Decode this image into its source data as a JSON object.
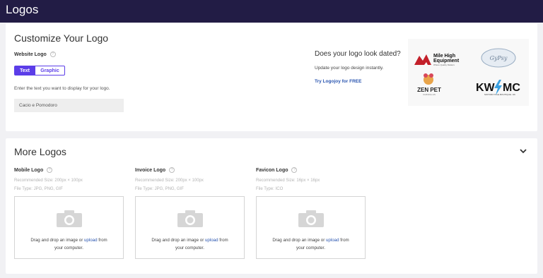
{
  "header": {
    "title": "Logos"
  },
  "customize": {
    "title": "Customize Your Logo",
    "website_logo_label": "Website Logo",
    "toggle": {
      "text": "Text",
      "graphic": "Graphic",
      "selected": "Text"
    },
    "instruction": "Enter the text you want to display for your logo.",
    "logo_text_value": "Cacio e Pomodoro"
  },
  "promo": {
    "title": "Does your logo look dated?",
    "subtitle": "Update your design instantly.",
    "subtitle_full": "Update your logo design instantly.",
    "link": "Try Logojoy for FREE",
    "samples": {
      "mile_high_1": "Mile High",
      "mile_high_2": "Equipment",
      "mile_high_3": "Where Quality Matters",
      "gypsy": "GyPsy",
      "zen_pet": "ZEN PET",
      "zen_pet_sub": "CHINCILLAS",
      "kwmc": "KW",
      "kwmc_2": "MC",
      "kwmc_sub": "MOTORCYCLE BOUTIQUE • 96"
    }
  },
  "more_logos": {
    "title": "More Logos",
    "items": [
      {
        "label": "Mobile Logo",
        "size": "Recommended Size: 200px × 100px",
        "type": "File Type: JPG, PNG, GIF"
      },
      {
        "label": "Invoice Logo",
        "size": "Recommended Size: 200px × 100px",
        "type": "File Type: JPG, PNG, GIF"
      },
      {
        "label": "Favicon Logo",
        "size": "Recommended Size: 16px × 16px",
        "type": "File Type: ICO"
      }
    ],
    "drop_before": "Drag and drop an image or ",
    "drop_link": "upload",
    "drop_after": " from",
    "drop_line2": "your computer."
  },
  "colors": {
    "header_bg": "#221c45",
    "accent": "#5b3de8",
    "link": "#2a55b0"
  }
}
